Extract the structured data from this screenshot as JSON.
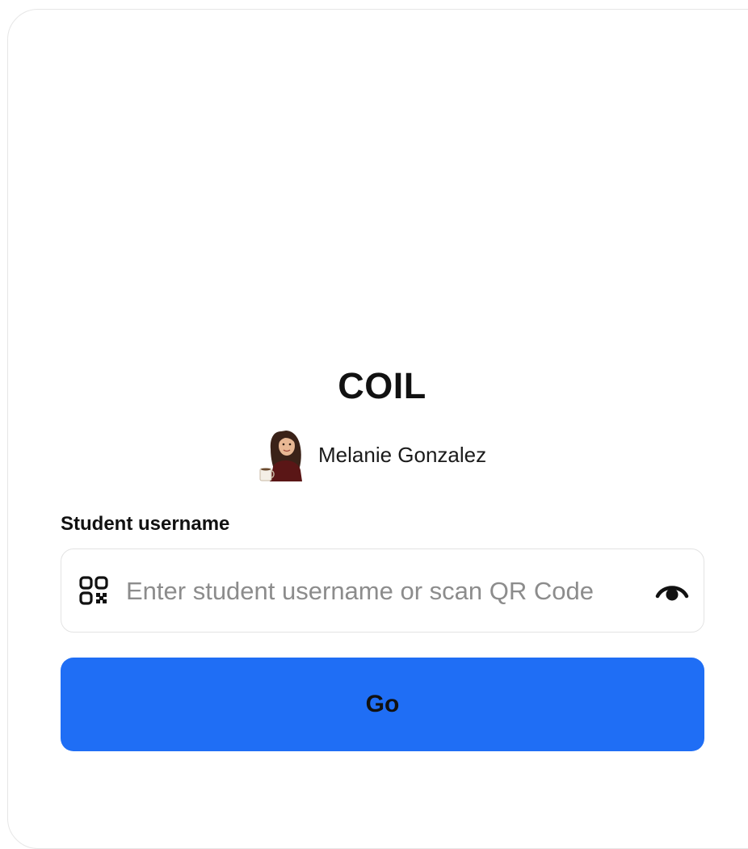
{
  "app": {
    "title": "COIL"
  },
  "teacher": {
    "name": "Melanie Gonzalez",
    "avatar": "bitmoji-avatar-with-coffee-mug"
  },
  "form": {
    "label": "Student username",
    "input_value": "",
    "placeholder": "Enter student username or scan QR Code",
    "left_icon": "qr-code-icon",
    "right_icon": "eye-icon",
    "submit_label": "Go"
  },
  "colors": {
    "primary_button": "#1f6ef5",
    "text": "#111111",
    "placeholder": "#8c8c8c",
    "border": "#e3e3e3"
  }
}
